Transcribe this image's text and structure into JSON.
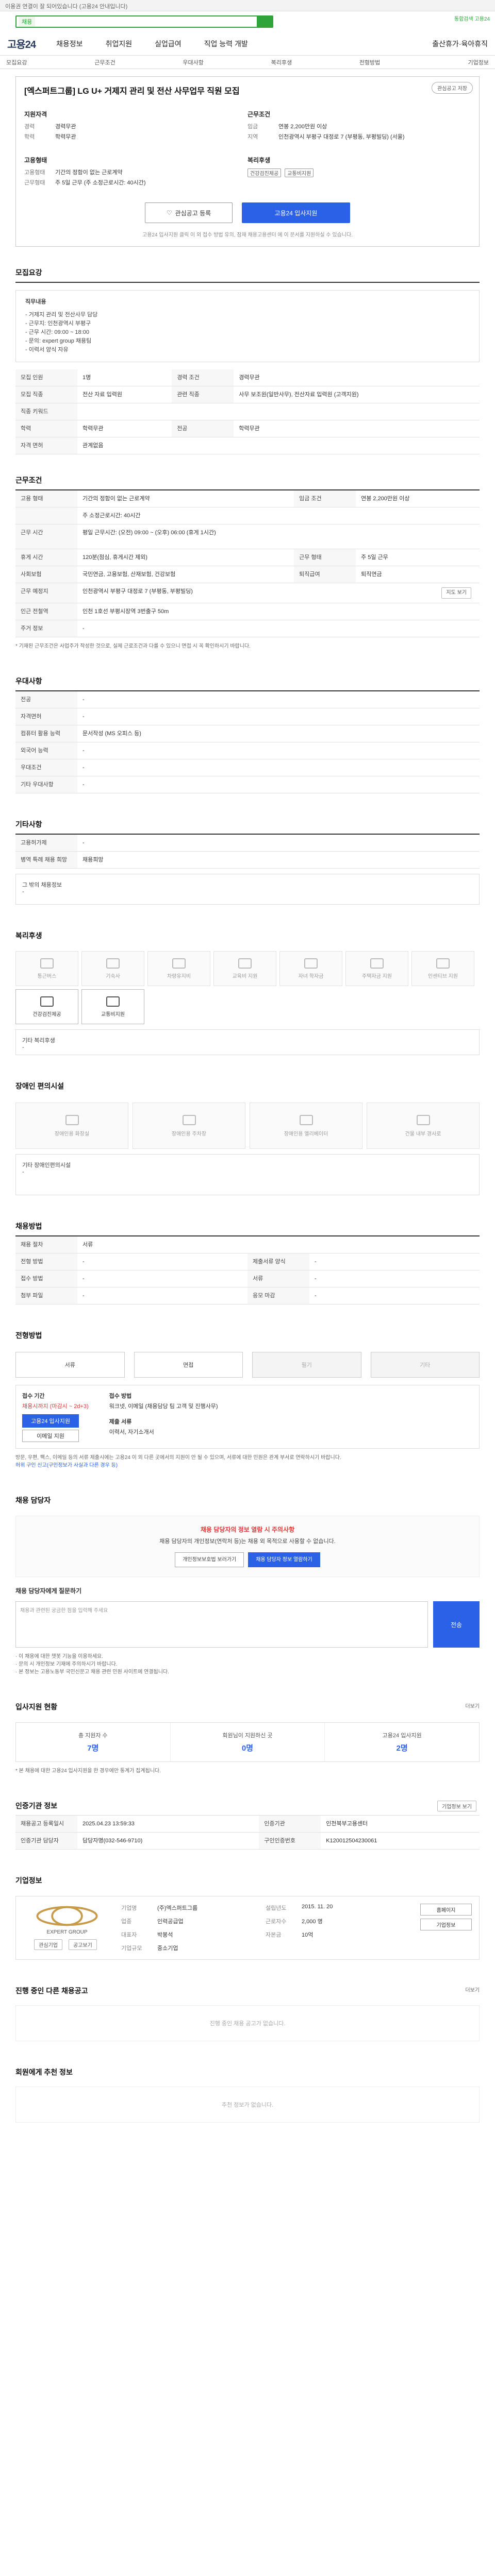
{
  "notice": "이용권 연결이 잘 되어있습니다 (고용24 안내입니다)",
  "top": {
    "search_tag": "채용",
    "right_link": "통합검색 고용24"
  },
  "nav": {
    "logo": "고용24",
    "items": [
      "채용정보",
      "취업지원",
      "실업급여",
      "직업 능력 개발"
    ],
    "right": "출산휴가·육아휴직"
  },
  "subnav": [
    "모집요강",
    "근무조건",
    "우대사항",
    "복리후생",
    "전형방법",
    "기업정보"
  ],
  "job": {
    "title": "[엑스퍼트그룹] LG U+ 거제지 관리 및 전산 사무업무 직원 모집",
    "save": "관심공고 저장",
    "recruit_h": "지원자격",
    "work_h": "근무조건",
    "recruit": [
      {
        "k": "경력",
        "v": "경력무관"
      },
      {
        "k": "학력",
        "v": "학력무관"
      }
    ],
    "work": [
      {
        "k": "임금",
        "v": "연봉 2,200만원 이상"
      },
      {
        "k": "지역",
        "v": "인천광역시 부평구 대정로 7 (부평동, 부평빌딩) (서울)"
      }
    ],
    "emp_h": "고용형태",
    "welfare_h": "복리후생",
    "emp": [
      {
        "k": "고용형태",
        "v": "기간의 정함이 없는 근로계약"
      },
      {
        "k": "근무형태",
        "v": "주 5일 근무 (주 소정근로시간: 40시간)"
      }
    ],
    "welfare": [
      "건강검진제공",
      "교통비지원"
    ],
    "btn_save": "관심공고 등록",
    "btn_apply": "고용24 입사지원",
    "note1": "고용24 입사지원 클릭 이 외 접수 방법 유의, 잠재 채용고용센터",
    "note2": "에 이 문서를 지원하실 수 있습니다."
  },
  "recruit_sec": {
    "title": "모집요강",
    "box_title": "직무내용",
    "box_lines": [
      "- 거제지 관리 및 전산사무 담당",
      "- 근무지: 인천광역시 부평구",
      "- 근무 시간: 09:00 ~ 18:00",
      "- 문의: expert group 채용팀",
      "- 이력서 양식 자유"
    ],
    "rows": [
      {
        "k": "모집 인원",
        "v": "1명",
        "k2": "경력 조건",
        "v2": "경력무관"
      },
      {
        "k": "모집 직종",
        "v": "전산 자료 입력원",
        "k2": "관련 직종",
        "v2": "사무 보조원(일반사무), 전산자료 입력원 (고객지원)"
      },
      {
        "k": "직종 키워드",
        "v": "",
        "k2": "",
        "v2": ""
      },
      {
        "k": "학력",
        "v": "학력무관",
        "k2": "전공",
        "v2": "학력무관"
      },
      {
        "k": "자격 면허",
        "v": "관계없음",
        "k2": "",
        "v2": ""
      }
    ]
  },
  "work_sec": {
    "title": "근무조건",
    "rows": [
      {
        "k": "고용 형태",
        "v": "기간의 정함이 없는 근로계약",
        "k2": "임금 조건",
        "v2": "연봉 2,200만원 이상"
      },
      {
        "k": "",
        "v": "주 소정근로시간: 40시간",
        "k2": "",
        "v2": ""
      },
      {
        "k": "근무 시간",
        "v": "평일 근무시간: (오전) 09:00 ~ (오후) 06:00 (휴게 1시간)",
        "k2": "",
        "v2": ""
      },
      {
        "k": "휴게 시간",
        "v": "120분(점심, 휴게시간 제외)",
        "k2": "근무 형태",
        "v2": "주 5일 근무"
      },
      {
        "k": "사회보험",
        "v": "국민연금, 고용보험, 산재보험, 건강보험",
        "k2": "퇴직급여",
        "v2": "퇴직연금"
      },
      {
        "k": "근무 예정지",
        "v": "인천광역시 부평구 대정로 7 (부평동, 부평빌딩)",
        "k2": "",
        "v2": ""
      },
      {
        "k": "인근 전철역",
        "v": "인천 1호선 부평시장역 3번출구 50m",
        "k2": "",
        "v2": ""
      },
      {
        "k": "주거 정보",
        "v": "-",
        "k2": "",
        "v2": ""
      }
    ],
    "map": "지도 보기",
    "foot": "* 기재된 근무조건은 사업주가 작성한 것으로, 실제 근로조건과 다를 수 있으니 면접 시 꼭 확인하시기 바랍니다."
  },
  "pref_sec": {
    "title": "우대사항",
    "rows": [
      {
        "k": "전공",
        "v": "-"
      },
      {
        "k": "자격면허",
        "v": "-"
      },
      {
        "k": "컴퓨터 활용 능력",
        "v": "문서작성 (MS 오피스 등)"
      },
      {
        "k": "외국어 능력",
        "v": "-"
      },
      {
        "k": "우대조건",
        "v": "-"
      },
      {
        "k": "기타 우대사항",
        "v": "-"
      }
    ]
  },
  "etc_sec": {
    "title": "기타사항",
    "rows": [
      {
        "k": "고용허가제",
        "v": "-"
      },
      {
        "k": "병역 특례 채용 희망",
        "v": "채용희망"
      }
    ],
    "sub": "그 밖의 채용정보",
    "sub_v": "-"
  },
  "welfare_sec": {
    "title": "복리후생",
    "icons": [
      {
        "label": "통근버스",
        "on": false
      },
      {
        "label": "기숙사",
        "on": false
      },
      {
        "label": "차량유지비",
        "on": false
      },
      {
        "label": "교육비 지원",
        "on": false
      },
      {
        "label": "자녀 학자금",
        "on": false
      },
      {
        "label": "주택자금 지원",
        "on": false
      },
      {
        "label": "인센티브 지원",
        "on": false
      },
      {
        "label": "건강검진제공",
        "on": true
      },
      {
        "label": "교통비지원",
        "on": true
      }
    ],
    "other": "기타 복리후생",
    "other_v": "-"
  },
  "disab_sec": {
    "title": "장애인 편의시설",
    "items": [
      "장애인용 화장실",
      "장애인용 주차장",
      "장애인용 엘리베이터",
      "건물 내부 경사로"
    ],
    "other": "기타 장애인편의시설",
    "other_v": "-"
  },
  "screen_sec": {
    "title": "채용방법",
    "rows": [
      {
        "k": "채용 절차",
        "v": "서류",
        "k2": "",
        "v2": ""
      },
      {
        "k": "전형 방법",
        "v": "-",
        "k2": "제출서류 양식",
        "v2": "-"
      },
      {
        "k": "접수 방법",
        "v": "-",
        "k2": "서류",
        "v2": "-"
      },
      {
        "k": "첨부 파일",
        "v": "-",
        "k2": "응모 마감",
        "v2": "-"
      }
    ]
  },
  "apply_sec": {
    "title": "전형방법",
    "tabs": [
      "서류",
      "면접",
      "필기",
      "기타"
    ],
    "period_label": "접수 기간",
    "period": "채용시까지 (마감시 ~ 2d+3)",
    "method_label": "접수 방법",
    "method": "워크넷, 이메일 (채용담당 팀 고객 및 진행사무)",
    "btn": "고용24 입사지원",
    "btn2": "이메일 지원",
    "doc_label": "제출 서류",
    "doc": "이력서, 자기소개서",
    "b1": "방문, 우편, 팩스, 이메일 등의 서류 제출시에는 고용24 이 외 다른 곳에서의 지원이 안 될 수 있으며, 서류에 대한 민원은 관계 부서로 연락하시기 바랍니다.",
    "b2": "허위 구인 신고(구인정보가 사실과 다른 경우 등)"
  },
  "contact_sec": {
    "title": "채용 담당자",
    "warn": "채용 담당자의 정보 열람 시 주의사항",
    "warn_txt": "채용 담당자의 개인정보(연락처 등)는 채용 외 목적으로 사용할 수 없습니다.",
    "b1": "개인정보보호법 보러가기",
    "b2": "채용 담당자 정보 열람하기",
    "msg_title": "채용 담당자에게 질문하기",
    "msg_ph": "채용과 관련된 궁금한 점을 입력해 주세요",
    "send": "전송",
    "tips": [
      "· 이 채용에 대한 챗봇 기능을 이용하세요.",
      "· 문의 시 개인정보 기재에 주의하시기 바랍니다.",
      "· 본 정보는 고용노동부 국민신문고 채용 관련 민원 사이트에 연결됩니다."
    ]
  },
  "stats_sec": {
    "title": "입사지원 현황",
    "more": "더보기",
    "items": [
      {
        "k": "총 지원자 수",
        "v": "7명"
      },
      {
        "k": "회원님이 지원하신 곳",
        "v": "0명"
      },
      {
        "k": "고용24 입사지원",
        "v": "2명"
      }
    ],
    "foot": "* 본 채용에 대한 고용24 입사지원을 한 경우에만 통계가 집계됩니다."
  },
  "info_sec": {
    "title": "인증기관 정보",
    "btn": "기업정보 보기",
    "rows": [
      {
        "k": "채용공고 등록일시",
        "v": "2025.04.23 13:59:33",
        "k2": "인증기관",
        "v2": "인천북부고용센터"
      },
      {
        "k": "인증기관 담당자",
        "v": "담당자명(032-546-9710)",
        "k2": "구인인증번호",
        "v2": "K120012504230061"
      }
    ]
  },
  "company_sec": {
    "title": "기업정보",
    "name": "EXPERT GROUP",
    "info": [
      {
        "k": "기업명",
        "v": "(주)엑스퍼트그룹"
      },
      {
        "k": "설립년도",
        "v": "2015. 11. 20"
      },
      {
        "k": "업종",
        "v": "인력공급업"
      },
      {
        "k": "근로자수",
        "v": "2,000 명"
      },
      {
        "k": "대표자",
        "v": "박봉석"
      },
      {
        "k": "자본금",
        "v": "10억"
      },
      {
        "k": "기업규모",
        "v": "중소기업"
      },
      {
        "k": "",
        "v": ""
      }
    ],
    "btns": [
      "홈페이지",
      "기업정보"
    ],
    "b_left": "관심기업",
    "b_right": "공고보기"
  },
  "other_sec": {
    "title": "진행 중인 다른 채용공고",
    "more": "더보기",
    "empty": "진행 중인 채용 공고가 없습니다."
  },
  "recommend_sec": {
    "title": "회원에게 추천 정보",
    "empty": "추천 정보가 없습니다."
  }
}
